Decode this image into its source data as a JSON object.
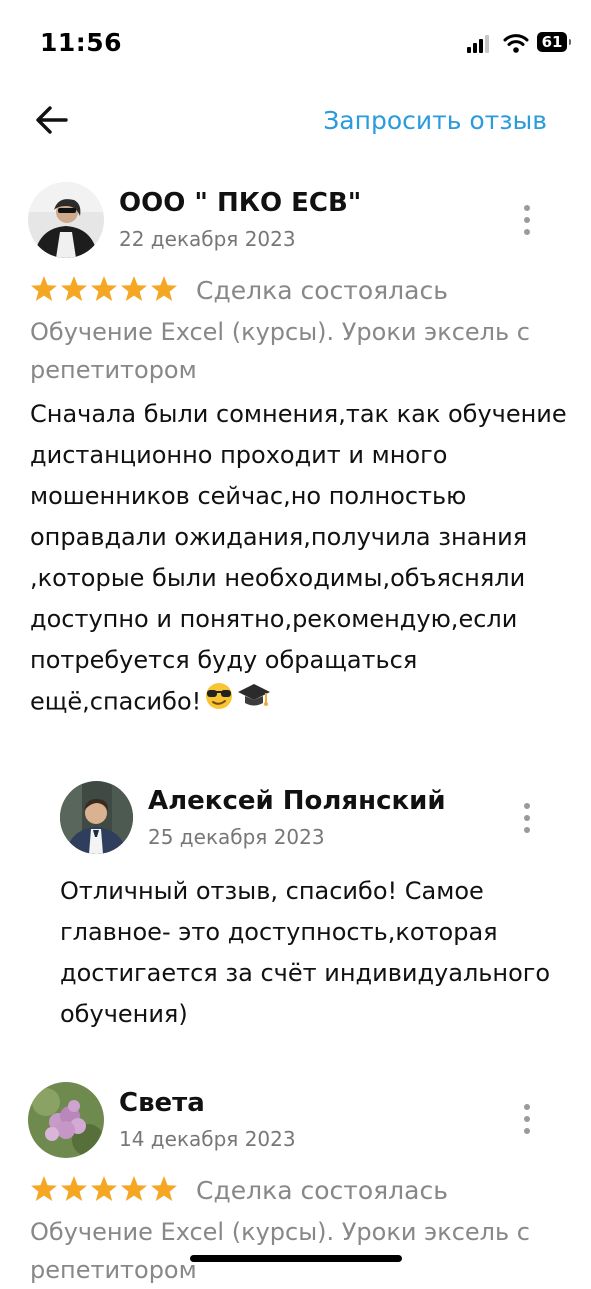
{
  "status_bar": {
    "time": "11:56",
    "battery": "61"
  },
  "header": {
    "request_review_label": "Запросить отзыв"
  },
  "reviews": [
    {
      "author": "ООО \" ПКО ЕСВ\"",
      "date": "22 декабря 2023",
      "rating": 5,
      "deal_status": "Сделка состоялась",
      "service": "Обучение Excel (курсы). Уроки эксель с репетитором",
      "text": "Сначала были сомнения,так как обучение дистанционно проходит и много мошенников сейчас,но полностью  оправдали ожидания,получила знания ,которые были необходимы,объясняли доступно и понятно,рекомендую,если потребуется буду обращаться ещё,спасибо!",
      "reply": {
        "author": "Алексей Полянский",
        "date": "25 декабря 2023",
        "text": "Отличный отзыв, спасибо! Самое главное- это доступность,которая достигается за счёт индивидуального обучения)"
      }
    },
    {
      "author": "Света",
      "date": "14 декабря 2023",
      "rating": 5,
      "deal_status": "Сделка состоялась",
      "service": "Обучение Excel (курсы). Уроки эксель с репетитором"
    }
  ],
  "colors": {
    "accent": "#2a9bdc",
    "star": "#f5a623",
    "muted": "#888888"
  }
}
